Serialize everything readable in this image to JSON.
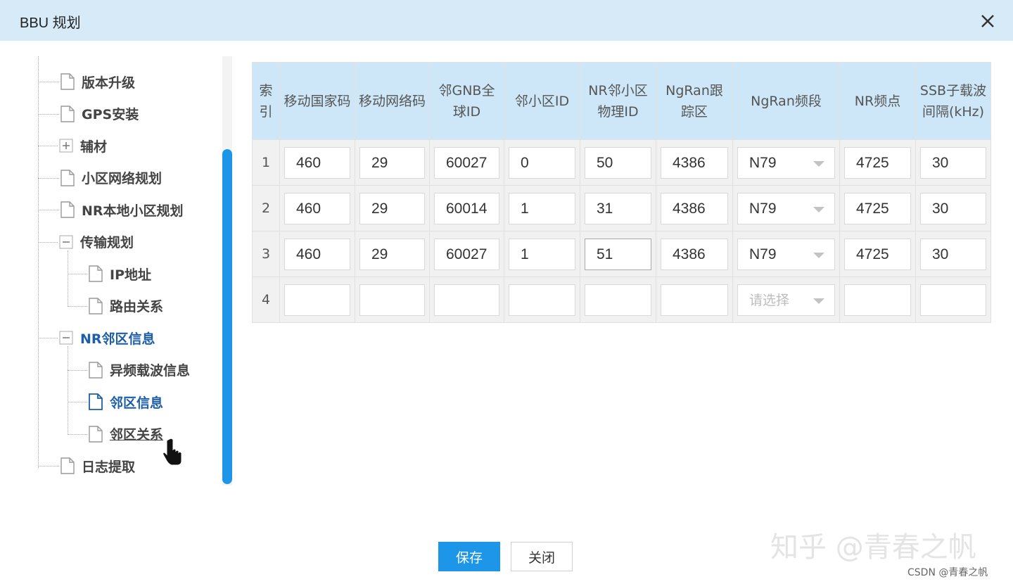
{
  "dialog": {
    "title": "BBU 规划"
  },
  "tree": {
    "items": [
      {
        "label": "版本升级",
        "type": "file",
        "level": 1,
        "state": "normal"
      },
      {
        "label": "GPS安装",
        "type": "file",
        "level": 1,
        "state": "normal"
      },
      {
        "label": "辅材",
        "type": "collapsed",
        "level": 1,
        "state": "normal"
      },
      {
        "label": "小区网络规划",
        "type": "file",
        "level": 1,
        "state": "normal"
      },
      {
        "label": "NR本地小区规划",
        "type": "file",
        "level": 1,
        "state": "normal"
      },
      {
        "label": "传输规划",
        "type": "expanded",
        "level": 1,
        "state": "normal"
      },
      {
        "label": "IP地址",
        "type": "file",
        "level": 2,
        "state": "normal"
      },
      {
        "label": "路由关系",
        "type": "file",
        "level": 2,
        "state": "normal"
      },
      {
        "label": "NR邻区信息",
        "type": "expanded",
        "level": 1,
        "state": "active"
      },
      {
        "label": "异频载波信息",
        "type": "file",
        "level": 2,
        "state": "normal"
      },
      {
        "label": "邻区信息",
        "type": "file",
        "level": 2,
        "state": "active"
      },
      {
        "label": "邻区关系",
        "type": "file",
        "level": 2,
        "state": "hover"
      },
      {
        "label": "日志提取",
        "type": "file",
        "level": 1,
        "state": "normal"
      }
    ]
  },
  "table": {
    "headers": [
      "索引",
      "移动国家码",
      "移动网络码",
      "邻GNB全球ID",
      "邻小区ID",
      "NR邻小区物理ID",
      "NgRan跟踪区",
      "NgRan频段",
      "NR频点",
      "SSB子载波间隔(kHz)"
    ],
    "rows": [
      {
        "index": "1",
        "mcc": "460",
        "mnc": "29",
        "gnb": "60027",
        "cell": "0",
        "pci": "50",
        "tac": "4386",
        "band": "N79",
        "freq": "4725",
        "scs": "30"
      },
      {
        "index": "2",
        "mcc": "460",
        "mnc": "29",
        "gnb": "60014",
        "cell": "1",
        "pci": "31",
        "tac": "4386",
        "band": "N79",
        "freq": "4725",
        "scs": "30"
      },
      {
        "index": "3",
        "mcc": "460",
        "mnc": "29",
        "gnb": "60027",
        "cell": "1",
        "pci": "51",
        "tac": "4386",
        "band": "N79",
        "freq": "4725",
        "scs": "30"
      },
      {
        "index": "4",
        "mcc": "",
        "mnc": "",
        "gnb": "",
        "cell": "",
        "pci": "",
        "tac": "",
        "band": "",
        "freq": "",
        "scs": ""
      }
    ],
    "select_placeholder": "请选择"
  },
  "footer": {
    "save_label": "保存",
    "close_label": "关闭"
  },
  "watermark": {
    "text": "知乎 @青春之帆",
    "csdn": "CSDN @青春之帆"
  },
  "colors": {
    "titlebar": "#d6ebf7",
    "header": "#cde7f8",
    "accent": "#1d96ea",
    "active_text": "#1c5ea8"
  }
}
